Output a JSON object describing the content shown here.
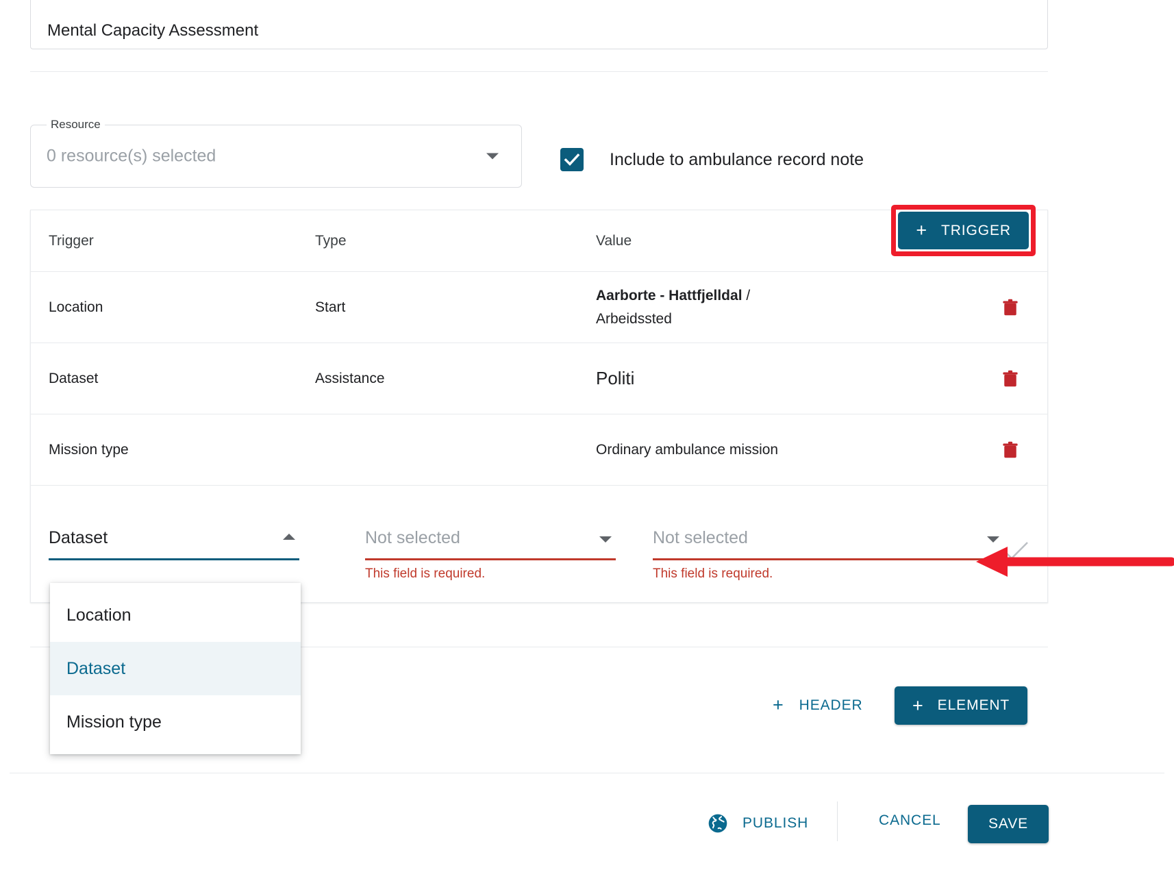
{
  "colors": {
    "accent_teal": "#0b5c7c",
    "link_teal": "#0b6a8f",
    "annotation_red": "#ee1d2b",
    "error_red": "#c0392b",
    "trash_red": "#c1272d",
    "dropdown_selected_bg": "#eef4f7"
  },
  "form": {
    "title_value": "Mental Capacity Assessment",
    "resource": {
      "legend": "Resource",
      "value": "0 resource(s) selected",
      "arrow_icon": "chevron-down-icon"
    },
    "include_note": {
      "label": "Include to ambulance record note",
      "checked": true,
      "icon": "check-icon"
    }
  },
  "trigger_table": {
    "columns": [
      "Trigger",
      "Type",
      "Value",
      ""
    ],
    "add_trigger_button": {
      "label": "TRIGGER",
      "plus": "+",
      "highlighted": true
    },
    "rows": [
      {
        "trigger": "Location",
        "type": "Start",
        "value_bold": "Aarborte - Hattfjelldal",
        "value_sep": " /",
        "value_second_line": "Arbeidssted",
        "delete_icon": "trash-icon"
      },
      {
        "trigger": "Dataset",
        "type": "Assistance",
        "value_bold": "",
        "value_plain": "Politi",
        "delete_icon": "trash-icon"
      },
      {
        "trigger": "Mission type",
        "type": "",
        "value_bold": "",
        "value_plain": "Ordinary ambulance mission",
        "delete_icon": "trash-icon"
      }
    ],
    "editor_row": {
      "trigger_select": {
        "value": "Dataset",
        "open": true,
        "caret_icon": "chevron-up-icon",
        "options": [
          "Location",
          "Dataset",
          "Mission type"
        ],
        "selected_option": "Dataset"
      },
      "type_select": {
        "placeholder": "Not selected",
        "error": "This field is required.",
        "caret_icon": "chevron-down-icon"
      },
      "value_select": {
        "placeholder": "Not selected",
        "error": "This field is required.",
        "caret_icon": "chevron-down-icon"
      },
      "confirm_icon": "check-icon"
    }
  },
  "builder_actions": {
    "header_button": {
      "label": "HEADER",
      "plus": "+"
    },
    "element_button": {
      "label": "ELEMENT",
      "plus": "+"
    }
  },
  "footer": {
    "publish": {
      "label": "PUBLISH",
      "icon": "globe-icon"
    },
    "cancel": {
      "label": "CANCEL"
    },
    "save": {
      "label": "SAVE"
    }
  },
  "annotations": {
    "arrow": {
      "icon": "arrow-left-icon",
      "points_to": "confirm-check-button"
    },
    "box": {
      "around": "add-trigger-button"
    }
  }
}
